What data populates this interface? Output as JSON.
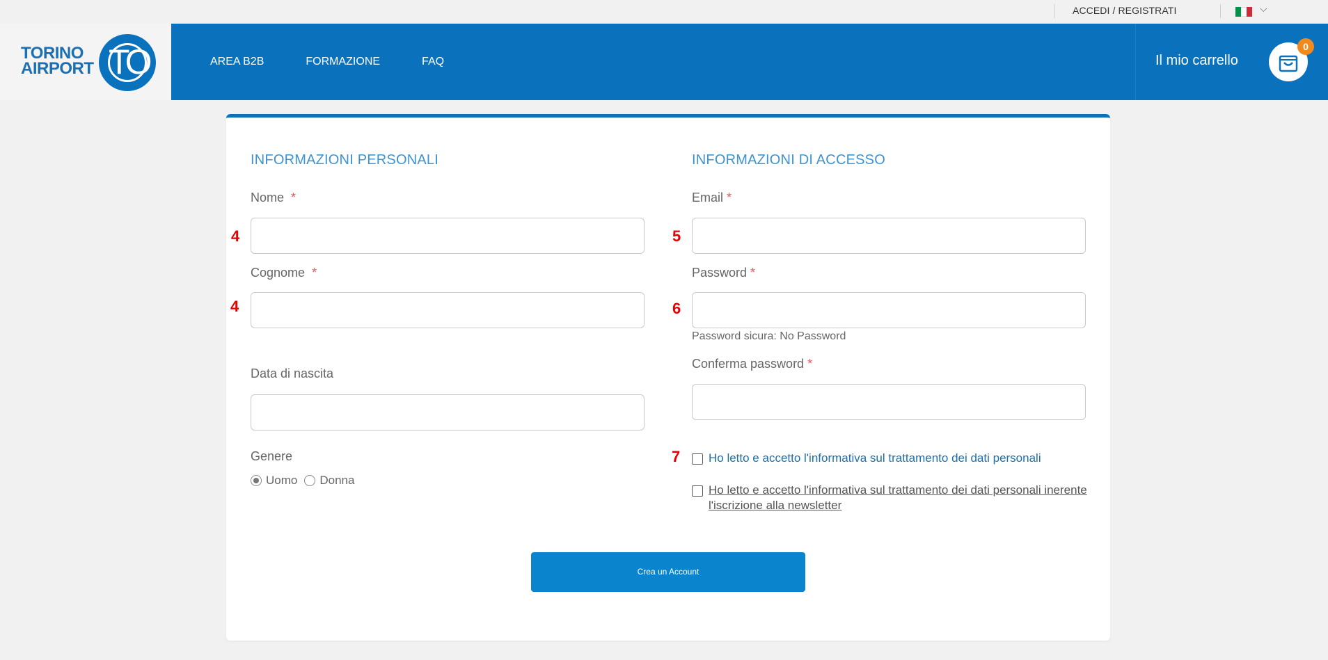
{
  "topbar": {
    "login_label": "ACCEDI / REGISTRATI",
    "language_flag": "italian-flag",
    "flag_colors": [
      "#009246",
      "#ffffff",
      "#ce2b37"
    ]
  },
  "header": {
    "logo_line1": "TORINO",
    "logo_line2": "AIRPORT",
    "logo_mark": "TO",
    "nav_items": [
      {
        "label": "AREA B2B"
      },
      {
        "label": "FORMAZIONE"
      },
      {
        "label": "FAQ"
      }
    ],
    "cart_label": "Il mio carrello",
    "cart_count": "0"
  },
  "form": {
    "personal": {
      "title": "INFORMAZIONI PERSONALI",
      "first_name_label": "Nome",
      "last_name_label": "Cognome",
      "birth_date_label": "Data di nascita",
      "gender_label": "Genere",
      "gender_options": [
        "Uomo",
        "Donna"
      ],
      "gender_selected": "Uomo",
      "first_name_value": "",
      "last_name_value": "",
      "birth_date_value": ""
    },
    "access": {
      "title": "INFORMAZIONI DI ACCESSO",
      "email_label": "Email",
      "password_label": "Password",
      "password_strength": "Password sicura: No Password",
      "confirm_label": "Conferma password",
      "email_value": "",
      "password_value": "",
      "confirm_value": "",
      "privacy_consent": "Ho letto e accetto l'informativa sul trattamento dei dati personali",
      "newsletter_consent": "Ho letto e accetto l'informativa sul trattamento dei dati personali inerente l'iscrizione alla newsletter"
    },
    "required_mark": "*",
    "submit_label": "Crea un Account"
  },
  "annotations": {
    "first_name": "4",
    "last_name": "4",
    "email": "5",
    "password": "6",
    "privacy": "7"
  },
  "colors": {
    "brand_blue": "#0a72bd",
    "section_title": "#3e93cf",
    "required": "#e85a5a",
    "annotation": "#e60000",
    "cart_badge": "#f08a1c"
  }
}
